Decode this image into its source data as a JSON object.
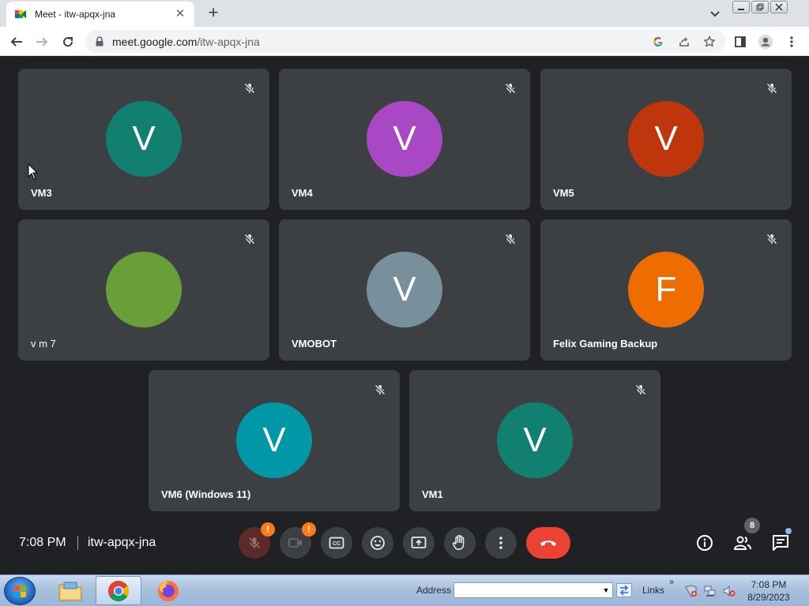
{
  "browser": {
    "tab_title": "Meet - itw-apqx-jna",
    "url_host": "meet.google.com",
    "url_path": "/itw-apqx-jna"
  },
  "participants": [
    {
      "name": "VM3",
      "initial": "V",
      "color": "#128070"
    },
    {
      "name": "VM4",
      "initial": "V",
      "color": "#a948c4"
    },
    {
      "name": "VM5",
      "initial": "V",
      "color": "#bf360c"
    },
    {
      "name": "v m 7",
      "initial": "",
      "color": "#689f38"
    },
    {
      "name": "VMOBOT",
      "initial": "V",
      "color": "#78909c"
    },
    {
      "name": "Felix Gaming Backup",
      "initial": "F",
      "color": "#ef6c00"
    },
    {
      "name": "VM6 (Windows 11)",
      "initial": "V",
      "color": "#0097a7"
    },
    {
      "name": "VM1",
      "initial": "V",
      "color": "#128070"
    }
  ],
  "meeting": {
    "time": "7:08 PM",
    "code": "itw-apqx-jna",
    "participant_count": "8",
    "mic_warning": "!",
    "cam_warning": "!"
  },
  "taskbar": {
    "address_label": "Address",
    "links_label": "Links",
    "tray_time": "7:08 PM",
    "tray_date": "8/29/2023"
  },
  "colors": {
    "meet_bg": "#202124",
    "tile_bg": "#3c4043",
    "leave_red": "#ea4335",
    "warning_orange": "#fa7b17"
  }
}
